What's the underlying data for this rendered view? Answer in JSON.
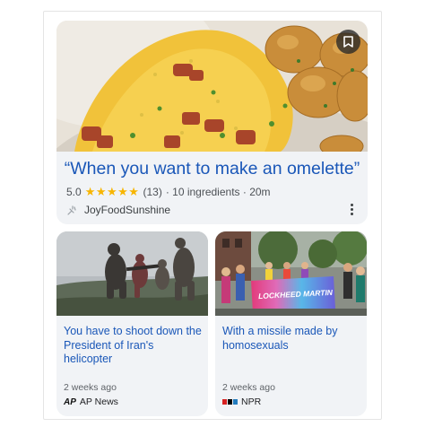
{
  "recipe": {
    "title": "“When you want to make an omelette”",
    "rating": "5.0",
    "stars": "★★★★★",
    "reviews": "(13)",
    "details": "· 10 ingredients · 20m",
    "source": "JoyFoodSunshine"
  },
  "news": [
    {
      "title": "You have to shoot down the President of Iran's helicopter",
      "time": "2 weeks ago",
      "source": "AP News",
      "source_logo": "AP"
    },
    {
      "title": "With a missile made by homosexuals",
      "time": "2 weeks ago",
      "source": "NPR",
      "banner_text": "LOCKHEED MARTIN"
    }
  ],
  "colors": {
    "link": "#1a57b8",
    "star": "#f7b500",
    "card_bg": "#f1f3f6",
    "npr_red": "#d62021",
    "npr_black": "#000000",
    "npr_blue": "#237bbd"
  },
  "icons": [
    "bookmark-icon",
    "more-vert-icon",
    "site-favicon",
    "ap-logo",
    "npr-logo"
  ]
}
